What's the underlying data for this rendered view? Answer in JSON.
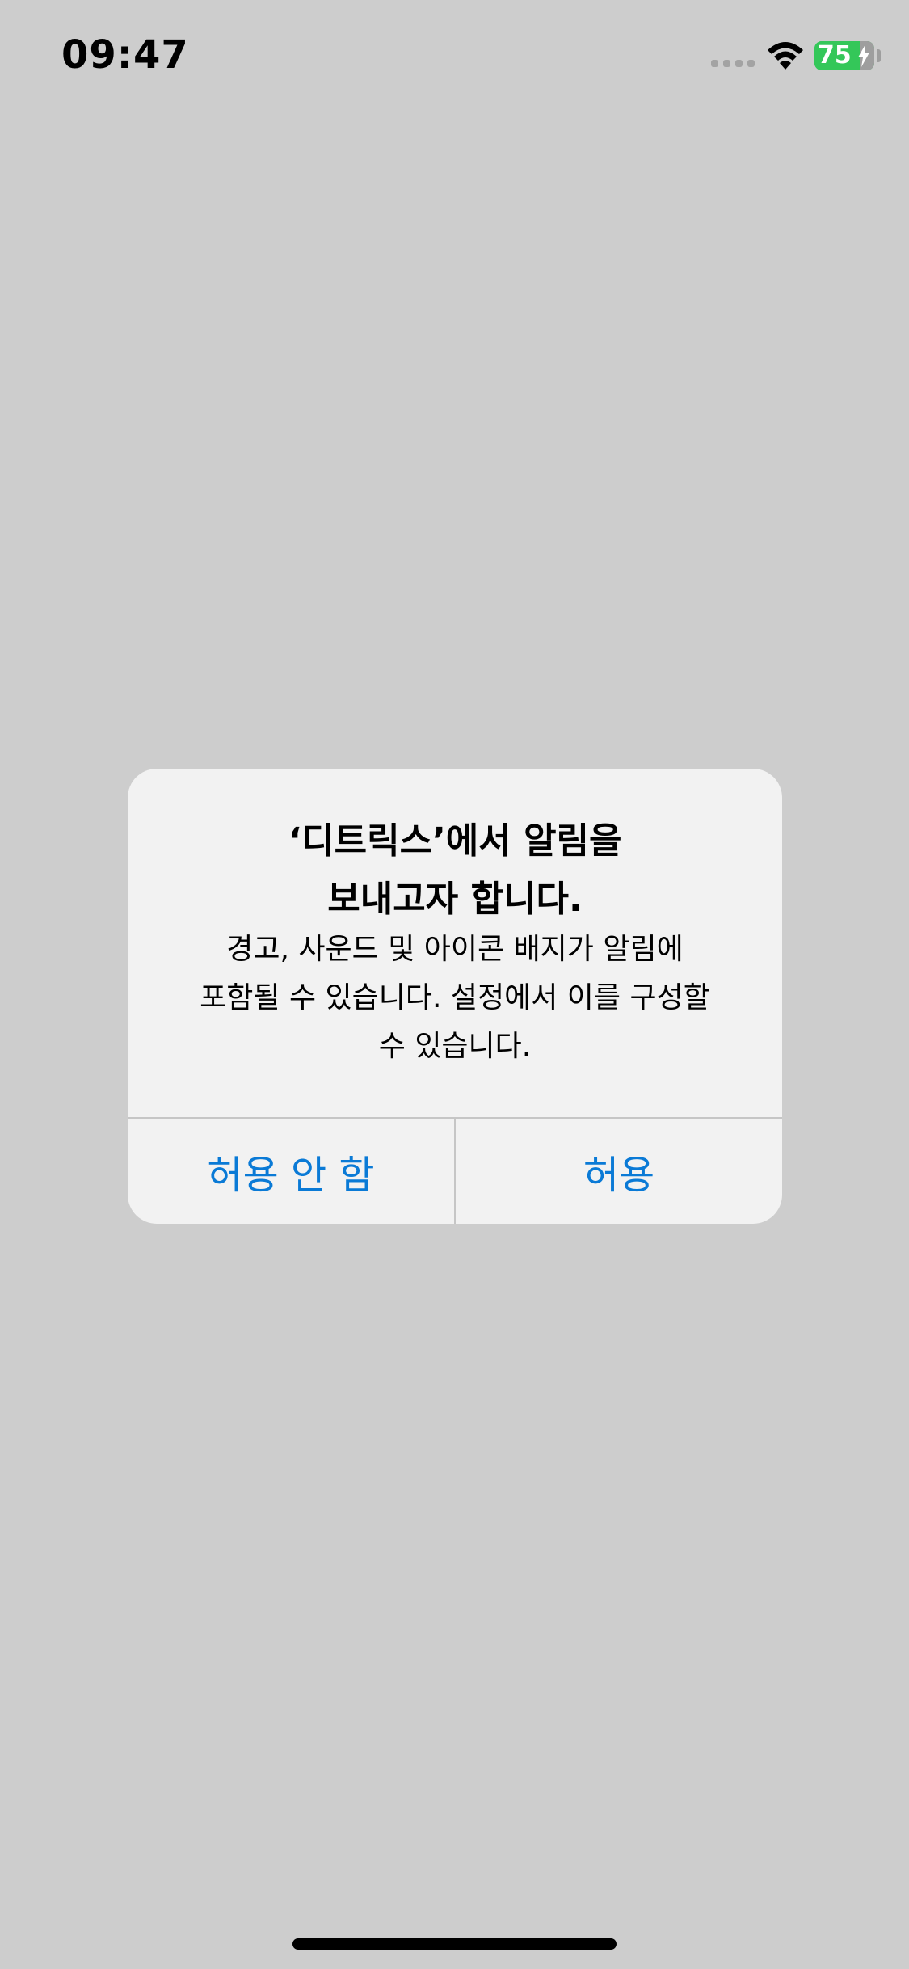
{
  "status_bar": {
    "time": "09:47",
    "battery_percent": "75",
    "battery_level": 0.75,
    "battery_charging": true,
    "icons": [
      "signal-icon",
      "wifi-icon",
      "battery-icon",
      "bolt-icon"
    ]
  },
  "alert": {
    "title_line1": "‘디트릭스’에서 알림을",
    "title_line2": "보내고자 합니다.",
    "message_line1": "경고, 사운드 및 아이콘 배지가 알림에",
    "message_line2": "포함될 수 있습니다. 설정에서 이를 구성할",
    "message_line3": "수 있습니다.",
    "deny_label": "허용 안 함",
    "allow_label": "허용"
  },
  "colors": {
    "background": "#cdcdcd",
    "alert_background": "#f2f2f2",
    "button_text": "#0a7ad6",
    "battery_green": "#34c759"
  }
}
